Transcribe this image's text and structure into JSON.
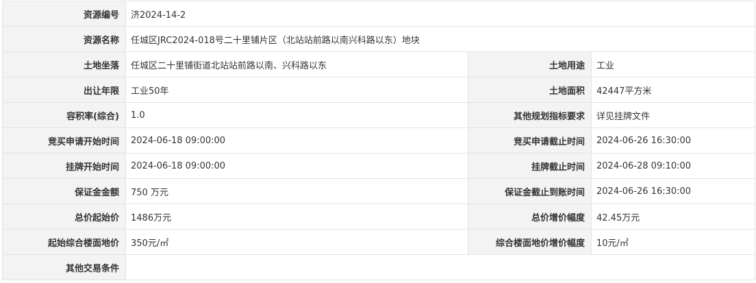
{
  "rows": [
    {
      "label": "资源编号",
      "value": "济2024-14-2"
    },
    {
      "label": "资源名称",
      "value": "任城区JRC2024-018号二十里铺片区（北站站前路以南兴科路以东）地块"
    },
    {
      "label": "土地坐落",
      "value": "任城区二十里铺街道北站站前路以南、兴科路以东",
      "label2": "土地用途",
      "value2": "工业"
    },
    {
      "label": "出让年限",
      "value": "工业50年",
      "label2": "土地面积",
      "value2": "42447平方米"
    },
    {
      "label": "容积率(综合)",
      "value": "1.0",
      "label2": "其他规划指标要求",
      "value2": "详见挂牌文件"
    },
    {
      "label": "竞买申请开始时间",
      "value": "2024-06-18 09:00:00",
      "label2": "竞买申请截止时间",
      "value2": "2024-06-26 16:30:00"
    },
    {
      "label": "挂牌开始时间",
      "value": "2024-06-18 09:00:00",
      "label2": "挂牌截止时间",
      "value2": "2024-06-28 09:10:00"
    },
    {
      "label": "保证金金额",
      "value": "750 万元",
      "label2": "保证金截止到账时间",
      "value2": "2024-06-26 16:30:00"
    },
    {
      "label": "总价起始价",
      "value": "1486万元",
      "label2": "总价增价幅度",
      "value2": "42.45万元"
    },
    {
      "label": "起始综合楼面地价",
      "value": "350元/㎡",
      "label2": "综合楼面地价增价幅度",
      "value2": "10元/㎡"
    },
    {
      "label": "其他交易条件",
      "value": ""
    }
  ]
}
